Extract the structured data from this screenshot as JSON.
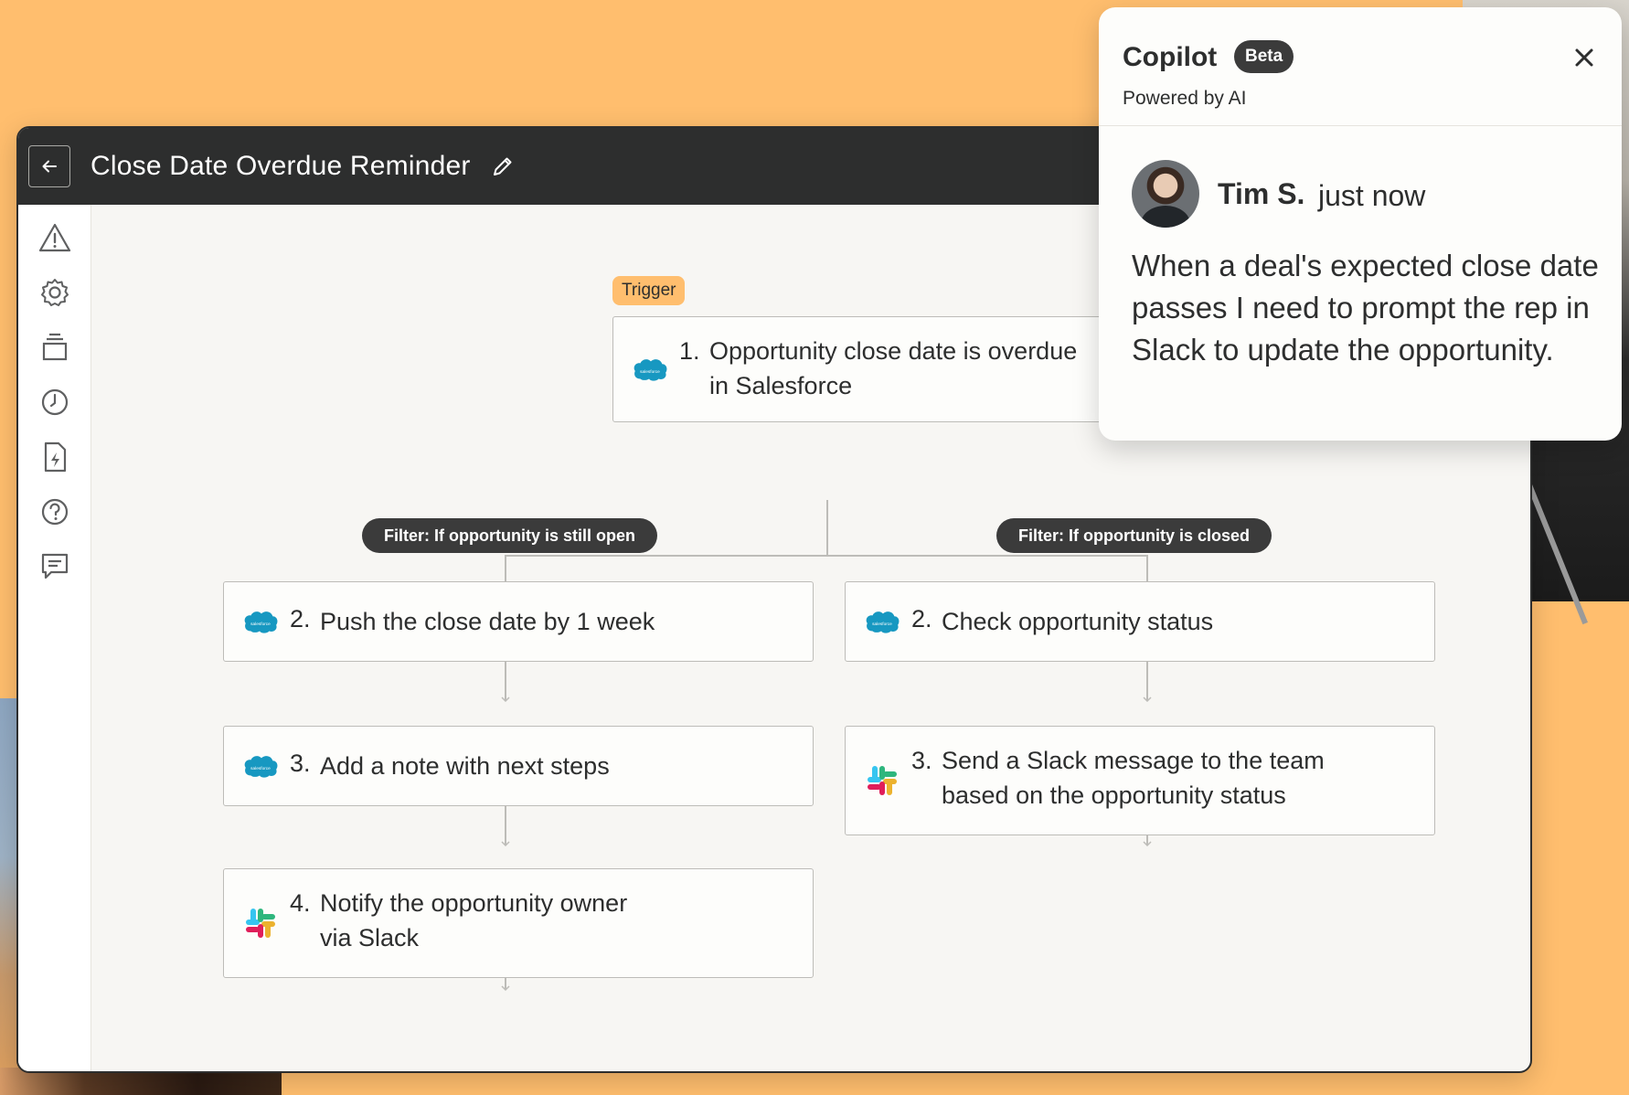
{
  "editor": {
    "title": "Close Date Overdue Reminder"
  },
  "trigger_tag": "Trigger",
  "steps": {
    "trigger": {
      "num": "1.",
      "text": [
        "Opportunity close date is overdue",
        "in Salesforce"
      ],
      "app": "salesforce"
    },
    "left_2": {
      "num": "2.",
      "text": "Push the close date by 1 week",
      "app": "salesforce"
    },
    "left_3": {
      "num": "3.",
      "text": "Add a note with next steps",
      "app": "salesforce"
    },
    "left_4": {
      "num": "4.",
      "text": [
        "Notify the opportunity owner",
        "via Slack"
      ],
      "app": "slack"
    },
    "right_2": {
      "num": "2.",
      "text": "Check opportunity status",
      "app": "salesforce"
    },
    "right_3": {
      "num": "3.",
      "text": [
        "Send a Slack message to the team",
        "based on the opportunity status"
      ],
      "app": "slack"
    }
  },
  "filters": {
    "left": "Filter: If opportunity is still open",
    "right": "Filter: If opportunity is closed"
  },
  "sidebar_icons": [
    "warning-icon",
    "gear-icon",
    "versions-icon",
    "history-icon",
    "zap-file-icon",
    "help-icon",
    "comment-icon"
  ],
  "copilot": {
    "title": "Copilot",
    "badge": "Beta",
    "subtitle": "Powered by AI",
    "author": "Tim S.",
    "time": "just now",
    "message": "When a deal's expected close date passes I need to prompt the rep in Slack to update the opportunity."
  },
  "colors": {
    "background": "#FFBE6E",
    "header": "#2d2e2e",
    "trigger_tag": "#FFBE6E",
    "filter_pill": "#3b3b3b",
    "salesforce_blue": "#1798c1"
  }
}
